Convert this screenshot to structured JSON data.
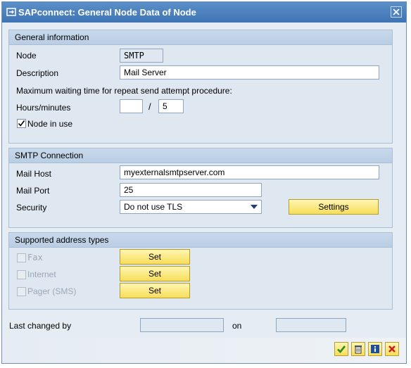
{
  "window": {
    "title": "SAPconnect: General Node Data of Node"
  },
  "general": {
    "header": "General information",
    "node_label": "Node",
    "node_value": "SMTP",
    "description_label": "Description",
    "description_value": "Mail Server",
    "max_wait_label": "Maximum waiting time for repeat send attempt procedure:",
    "hours_minutes_label": "Hours/minutes",
    "hours_value": "",
    "slash": "/",
    "minutes_value": "5",
    "node_in_use_label": "Node in use",
    "node_in_use_checked": true
  },
  "smtp": {
    "header": "SMTP Connection",
    "mail_host_label": "Mail Host",
    "mail_host_value": "myexternalsmtpserver.com",
    "mail_port_label": "Mail Port",
    "mail_port_value": "25",
    "security_label": "Security",
    "security_value": "Do not use TLS",
    "settings_button": "Settings"
  },
  "address_types": {
    "header": "Supported address types",
    "items": [
      {
        "label": "Fax",
        "button": "Set"
      },
      {
        "label": "Internet",
        "button": "Set"
      },
      {
        "label": "Pager (SMS)",
        "button": "Set"
      }
    ]
  },
  "footer": {
    "last_changed_label": "Last changed by",
    "last_changed_value": "",
    "on_label": "on",
    "on_value": ""
  },
  "icons": [
    "sap-window-icon",
    "close-icon",
    "check-icon",
    "delete-icon",
    "info-icon",
    "cancel-icon"
  ],
  "colors": {
    "titlebar": "#3f74b5",
    "button": "#f7dd5a",
    "group_bg": "#dfe8f1"
  }
}
